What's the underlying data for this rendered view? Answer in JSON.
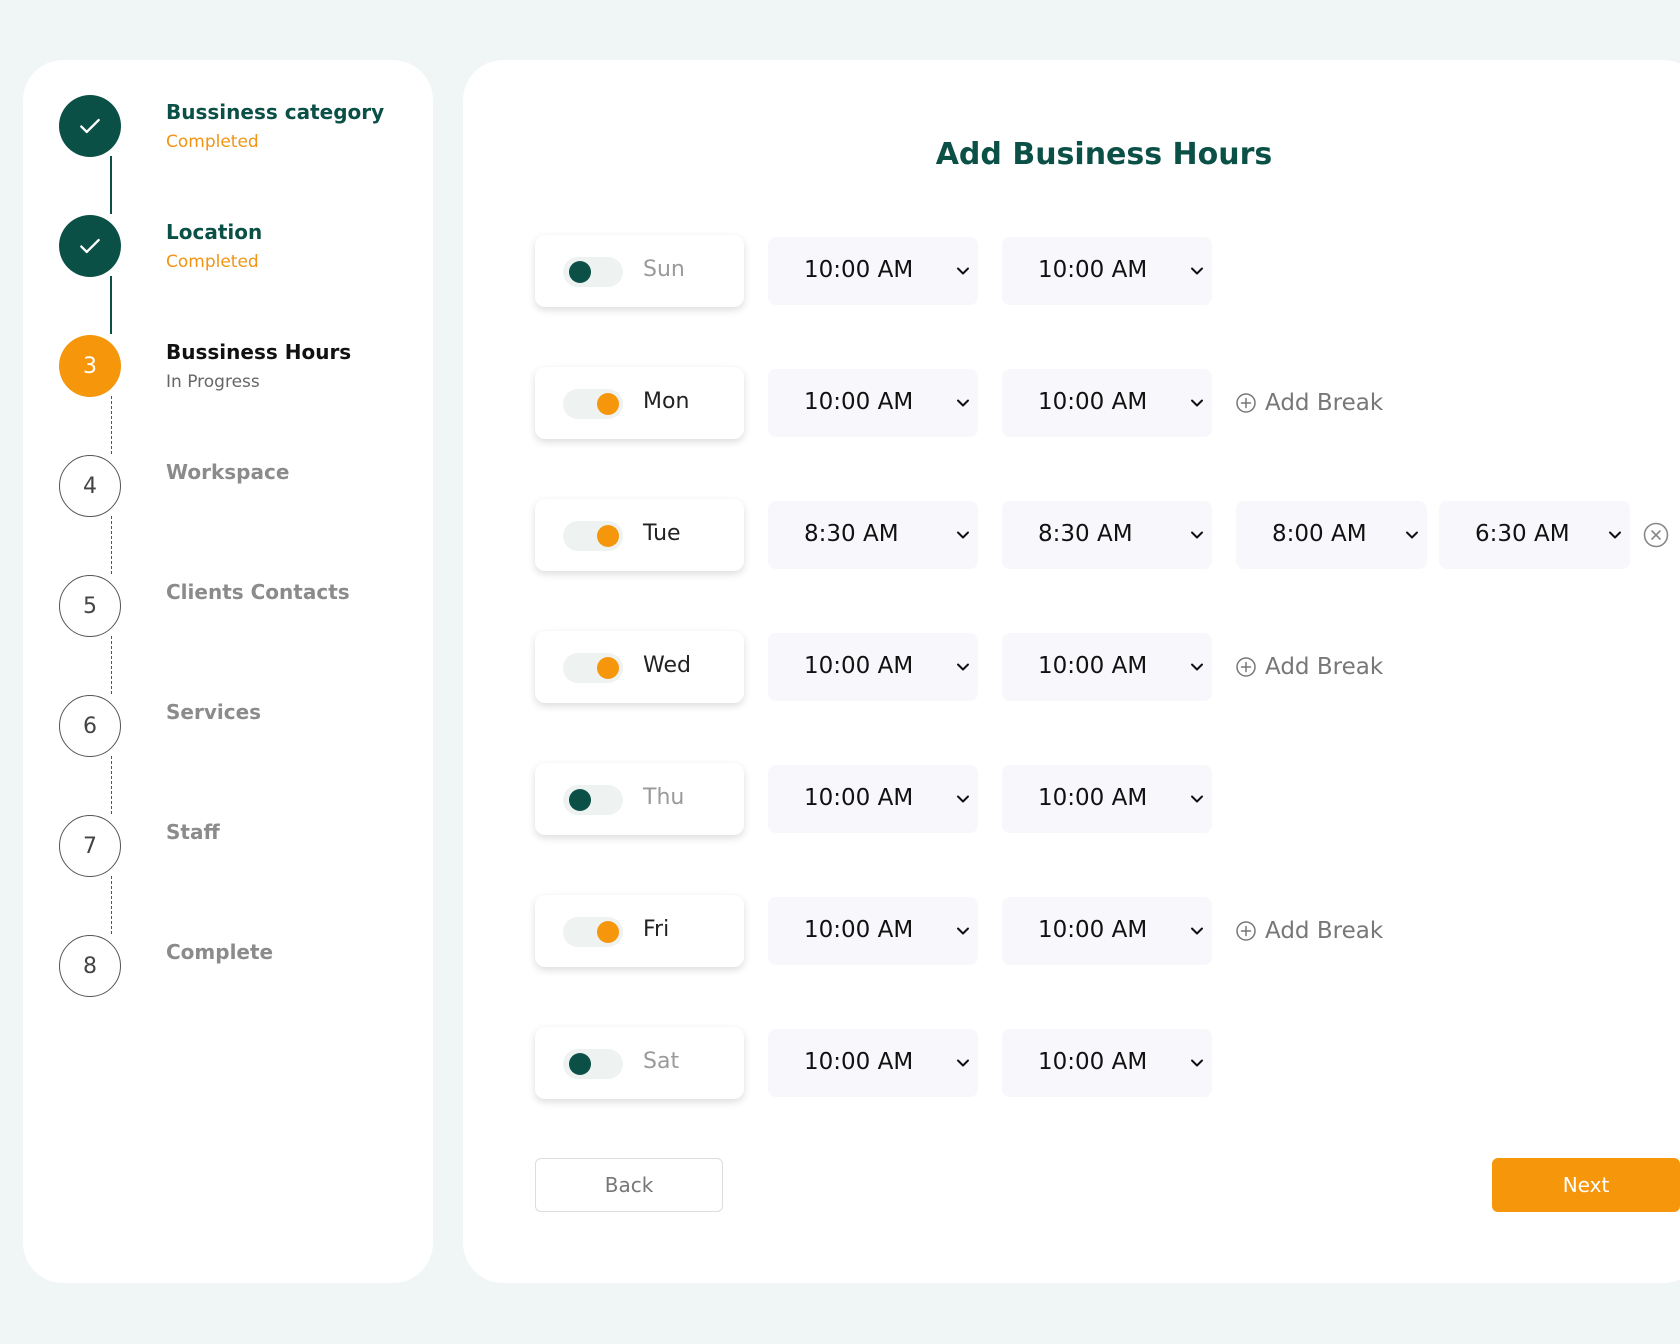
{
  "colors": {
    "brand_green": "#0b5046",
    "accent_orange": "#f6960b",
    "page_bg": "#eff6f5"
  },
  "steps": [
    {
      "number": "1",
      "title": "Bussiness category",
      "status": "Completed",
      "state": "done"
    },
    {
      "number": "2",
      "title": "Location",
      "status": "Completed",
      "state": "done"
    },
    {
      "number": "3",
      "title": "Bussiness Hours",
      "status": "In Progress",
      "state": "progress"
    },
    {
      "number": "4",
      "title": "Workspace",
      "status": "",
      "state": "todo"
    },
    {
      "number": "5",
      "title": "Clients Contacts",
      "status": "",
      "state": "todo"
    },
    {
      "number": "6",
      "title": "Services",
      "status": "",
      "state": "todo"
    },
    {
      "number": "7",
      "title": "Staff",
      "status": "",
      "state": "todo"
    },
    {
      "number": "8",
      "title": "Complete",
      "status": "",
      "state": "todo"
    }
  ],
  "main": {
    "title": "Add Business Hours",
    "add_break_label": "Add Break",
    "days": [
      {
        "day": "Sun",
        "enabled": false,
        "open": "10:00 AM",
        "close": "10:00 AM"
      },
      {
        "day": "Mon",
        "enabled": true,
        "open": "10:00 AM",
        "close": "10:00 AM",
        "add_break": true
      },
      {
        "day": "Tue",
        "enabled": true,
        "open": "8:30 AM",
        "close": "8:30 AM",
        "break_start": "8:00 AM",
        "break_end": "6:30 AM"
      },
      {
        "day": "Wed",
        "enabled": true,
        "open": "10:00 AM",
        "close": "10:00 AM",
        "add_break": true
      },
      {
        "day": "Thu",
        "enabled": false,
        "open": "10:00 AM",
        "close": "10:00 AM"
      },
      {
        "day": "Fri",
        "enabled": true,
        "open": "10:00 AM",
        "close": "10:00 AM",
        "add_break": true
      },
      {
        "day": "Sat",
        "enabled": false,
        "open": "10:00 AM",
        "close": "10:00 AM"
      }
    ],
    "back_label": "Back",
    "next_label": "Next"
  }
}
